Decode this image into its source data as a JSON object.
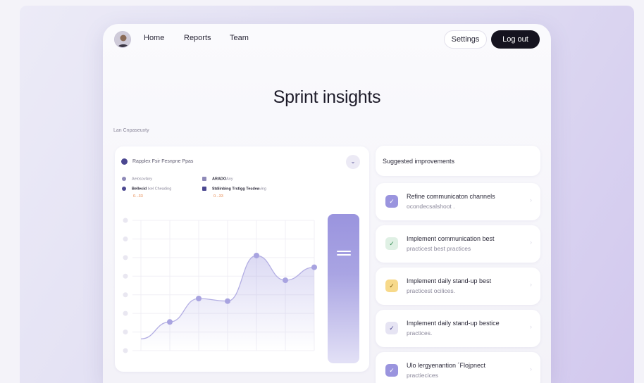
{
  "nav": {
    "links": [
      "Home",
      "Reports",
      "Team"
    ],
    "settings_label": "Settings",
    "logout_label": "Log out"
  },
  "page": {
    "title": "Sprint insights",
    "section_label": "Lan Cnpaseuxty"
  },
  "chart_card": {
    "header": "Rapplex Fsir Fesnpne Ppas",
    "legend": [
      {
        "label": "Aelosov",
        "suffix": "Any",
        "sub": ""
      },
      {
        "label": "ARADO",
        "suffix": "Any",
        "sub": ""
      },
      {
        "label": "Bellecid",
        "suffix": "Ixel Cheading",
        "sub": "0...33"
      },
      {
        "label": "Stdiinbing Trstigg Tesdea",
        "suffix": "ving",
        "sub": "0...33"
      }
    ],
    "accent_color": "#9a94de"
  },
  "chart_data": {
    "type": "area",
    "x": [
      1,
      2,
      3,
      4,
      5,
      6,
      7
    ],
    "series": [
      {
        "values": [
          9,
          22,
          40,
          38,
          73,
          54,
          64
        ]
      }
    ],
    "ylim": [
      0,
      100
    ],
    "grid": true
  },
  "suggestions": {
    "header": "Suggested improvements",
    "items": [
      {
        "title": "Refine communicaton channels",
        "subtitle": "ocondecsalshoot .",
        "check_bg": "#9a94de",
        "check_color": "#ffffff"
      },
      {
        "title": "Implement communication best",
        "subtitle": "practicest best practices",
        "check_bg": "#dff0e4",
        "check_color": "#2f8a4f"
      },
      {
        "title": "Implement daily stand-up best",
        "subtitle": "practicest ocilices.",
        "check_bg": "#f7d98a",
        "check_color": "#7a5a10"
      },
      {
        "title": "Implement daily stand-up bestice",
        "subtitle": "practices.",
        "check_bg": "#e6e4f3",
        "check_color": "#4b4790"
      },
      {
        "title": "Ulo lergyenantion ´Flojpnect",
        "subtitle": "practiecices",
        "check_bg": "#9a94de",
        "check_color": "#ffffff"
      }
    ]
  }
}
